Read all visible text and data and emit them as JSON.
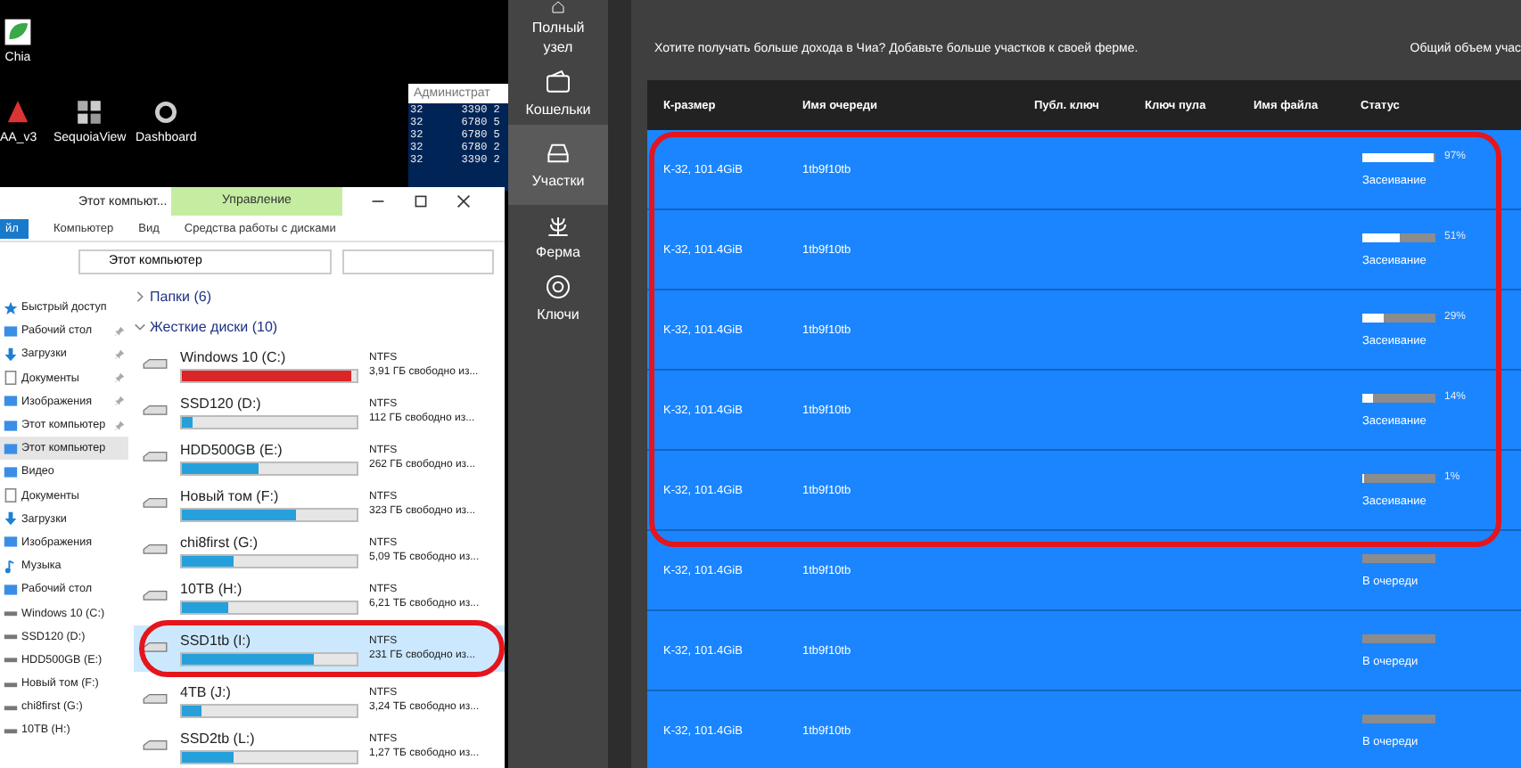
{
  "desktop": {
    "icons": [
      {
        "label": "Chia",
        "kind": "leaf"
      },
      {
        "label": "AA_v3",
        "kind": "app"
      },
      {
        "label": "SequoiaView",
        "kind": "grid"
      },
      {
        "label": "Dashboard",
        "kind": "gear"
      }
    ]
  },
  "console": {
    "title": "Администрат",
    "lines": [
      "32      3390 2",
      "32      6780 5",
      "32      6780 5",
      "32      6780 2",
      "32      3390 2"
    ]
  },
  "explorer": {
    "title": "Этот компьют...",
    "manage_tab": "Управление",
    "ribbon_tabs": [
      {
        "label": "йл",
        "selected": true
      },
      {
        "label": "Компьютер",
        "selected": false
      },
      {
        "label": "Вид",
        "selected": false
      },
      {
        "label": "Средства работы с дисками",
        "selected": false
      }
    ],
    "address": "Этот компьютер",
    "nav": [
      {
        "label": "Быстрый доступ",
        "kind": "star",
        "pinned": false,
        "selected": false
      },
      {
        "label": "Рабочий стол",
        "kind": "desktop",
        "pinned": true,
        "selected": false
      },
      {
        "label": "Загрузки",
        "kind": "download",
        "pinned": true,
        "selected": false
      },
      {
        "label": "Документы",
        "kind": "doc",
        "pinned": true,
        "selected": false
      },
      {
        "label": "Изображения",
        "kind": "image",
        "pinned": true,
        "selected": false
      },
      {
        "label": "Этот компьютер",
        "kind": "computer",
        "pinned": true,
        "selected": false
      },
      {
        "label": "Этот компьютер",
        "kind": "computer",
        "pinned": false,
        "selected": true
      },
      {
        "label": "Видео",
        "kind": "video",
        "pinned": false,
        "selected": false
      },
      {
        "label": "Документы",
        "kind": "doc",
        "pinned": false,
        "selected": false
      },
      {
        "label": "Загрузки",
        "kind": "download",
        "pinned": false,
        "selected": false
      },
      {
        "label": "Изображения",
        "kind": "image",
        "pinned": false,
        "selected": false
      },
      {
        "label": "Музыка",
        "kind": "music",
        "pinned": false,
        "selected": false
      },
      {
        "label": "Рабочий стол",
        "kind": "desktop",
        "pinned": false,
        "selected": false
      },
      {
        "label": "Windows 10 (C:)",
        "kind": "drive",
        "pinned": false,
        "selected": false
      },
      {
        "label": "SSD120 (D:)",
        "kind": "drive",
        "pinned": false,
        "selected": false
      },
      {
        "label": "HDD500GB (E:)",
        "kind": "drive",
        "pinned": false,
        "selected": false
      },
      {
        "label": "Новый том (F:)",
        "kind": "drive",
        "pinned": false,
        "selected": false
      },
      {
        "label": "chi8first (G:)",
        "kind": "drive",
        "pinned": false,
        "selected": false
      },
      {
        "label": "10TB (H:)",
        "kind": "drive",
        "pinned": false,
        "selected": false
      }
    ],
    "groups": [
      {
        "label": "Папки (6)",
        "expanded": false
      },
      {
        "label": "Жесткие диски (10)",
        "expanded": true
      }
    ],
    "drives": [
      {
        "name": "Windows 10 (C:)",
        "fs": "NTFS",
        "free": "3,91 ГБ свободно из...",
        "level": 0.97,
        "color": "#da2626",
        "selected": false
      },
      {
        "name": "SSD120 (D:)",
        "fs": "NTFS",
        "free": "112 ГБ свободно из...",
        "level": 0.06,
        "color": "#26a0da",
        "selected": false
      },
      {
        "name": "HDD500GB (E:)",
        "fs": "NTFS",
        "free": "262 ГБ свободно из...",
        "level": 0.44,
        "color": "#26a0da",
        "selected": false
      },
      {
        "name": "Новый том (F:)",
        "fs": "NTFS",
        "free": "323 ГБ свободно из...",
        "level": 0.65,
        "color": "#26a0da",
        "selected": false
      },
      {
        "name": "chi8first (G:)",
        "fs": "NTFS",
        "free": "5,09 ТБ свободно из...",
        "level": 0.3,
        "color": "#26a0da",
        "selected": false
      },
      {
        "name": "10TB (H:)",
        "fs": "NTFS",
        "free": "6,21 ТБ свободно из...",
        "level": 0.27,
        "color": "#26a0da",
        "selected": false
      },
      {
        "name": "SSD1tb (I:)",
        "fs": "NTFS",
        "free": "231 ГБ свободно из...",
        "level": 0.75,
        "color": "#26a0da",
        "selected": true
      },
      {
        "name": "4TB (J:)",
        "fs": "NTFS",
        "free": "3,24 ТБ свободно из...",
        "level": 0.11,
        "color": "#26a0da",
        "selected": false
      },
      {
        "name": "SSD2tb (L:)",
        "fs": "NTFS",
        "free": "1,27 ТБ свободно из...",
        "level": 0.3,
        "color": "#26a0da",
        "selected": false
      }
    ]
  },
  "chia": {
    "nav": [
      {
        "label": "Полный узел",
        "kind": "node",
        "selected": false
      },
      {
        "label": "Кошельки",
        "kind": "wallet",
        "selected": false
      },
      {
        "label": "Участки",
        "kind": "plots",
        "selected": true
      },
      {
        "label": "Ферма",
        "kind": "farm",
        "selected": false
      },
      {
        "label": "Ключи",
        "kind": "keys",
        "selected": false
      }
    ],
    "prompt": "Хотите получать больше дохода в Чиа? Добавьте больше участков к своей ферме.",
    "total_label": "Общий объем учас",
    "columns": [
      "К-размер",
      "Имя очереди",
      "Публ. ключ",
      "Ключ пула",
      "Имя файла",
      "Статус"
    ],
    "rows": [
      {
        "size": "K-32, 101.4GiB",
        "queue": "1tb9f10tb",
        "kind": "plotting",
        "level": 0.97,
        "percent": "97%",
        "status": "Засеивание"
      },
      {
        "size": "K-32, 101.4GiB",
        "queue": "1tb9f10tb",
        "kind": "plotting",
        "level": 0.51,
        "percent": "51%",
        "status": "Засеивание"
      },
      {
        "size": "K-32, 101.4GiB",
        "queue": "1tb9f10tb",
        "kind": "plotting",
        "level": 0.29,
        "percent": "29%",
        "status": "Засеивание"
      },
      {
        "size": "K-32, 101.4GiB",
        "queue": "1tb9f10tb",
        "kind": "plotting",
        "level": 0.14,
        "percent": "14%",
        "status": "Засеивание"
      },
      {
        "size": "K-32, 101.4GiB",
        "queue": "1tb9f10tb",
        "kind": "plotting",
        "level": 0.01,
        "percent": "1%",
        "status": "Засеивание"
      },
      {
        "size": "K-32, 101.4GiB",
        "queue": "1tb9f10tb",
        "kind": "queued",
        "status": "В очереди"
      },
      {
        "size": "K-32, 101.4GiB",
        "queue": "1tb9f10tb",
        "kind": "queued",
        "status": "В очереди"
      },
      {
        "size": "K-32, 101.4GiB",
        "queue": "1tb9f10tb",
        "kind": "queued",
        "status": "В очереди"
      }
    ]
  }
}
